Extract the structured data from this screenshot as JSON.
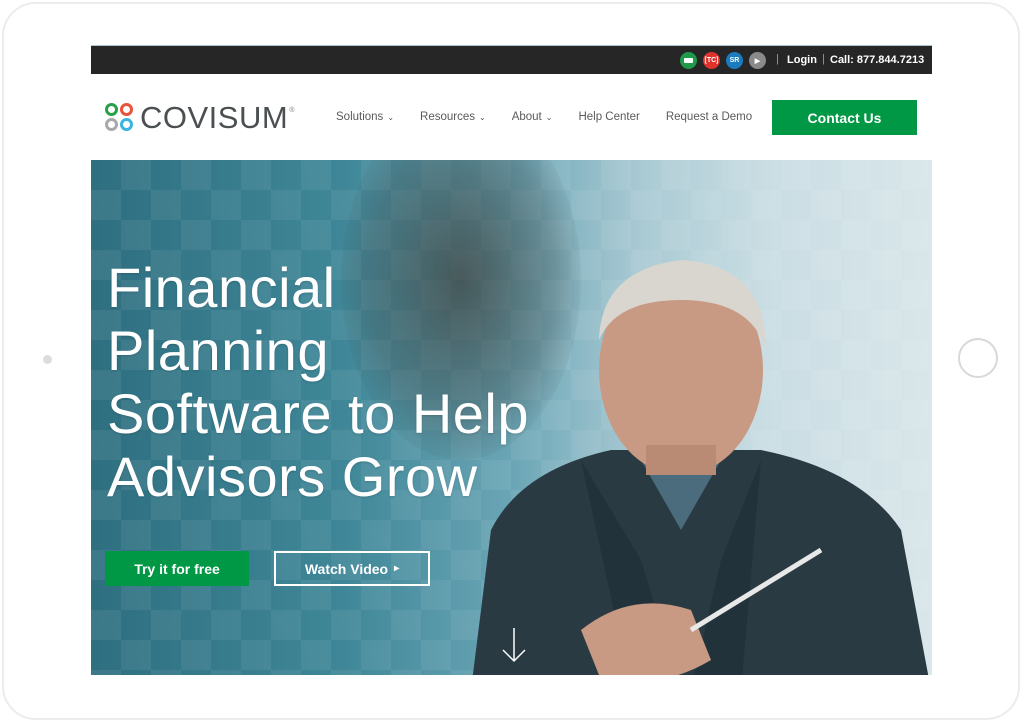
{
  "topbar": {
    "icons": [
      {
        "name": "social-green-icon",
        "label": "",
        "color": "#1e9a4a"
      },
      {
        "name": "tc-icon",
        "label": "[TC]",
        "color": "#e0322c"
      },
      {
        "name": "sr-icon",
        "label": "SR",
        "color": "#1a7bbf"
      },
      {
        "name": "play-icon",
        "label": "▶",
        "color": "#8a8a8a"
      }
    ],
    "login": "Login",
    "call": "Call: 877.844.7213"
  },
  "nav": {
    "logo_text": "COVISUM",
    "logo_reg": "®",
    "menu": [
      {
        "label": "Solutions",
        "has_dropdown": true
      },
      {
        "label": "Resources",
        "has_dropdown": true
      },
      {
        "label": "About",
        "has_dropdown": true
      },
      {
        "label": "Help Center",
        "has_dropdown": false
      },
      {
        "label": "Request a Demo",
        "has_dropdown": false
      }
    ],
    "contact_label": "Contact Us"
  },
  "hero": {
    "headline_lines": [
      "Financial",
      "Planning",
      "Software to Help",
      "Advisors Grow"
    ],
    "try_label": "Try it for free",
    "watch_label": "Watch Video",
    "watch_icon": "▸"
  },
  "colors": {
    "accent_green": "#009845",
    "topbar_bg": "#262626"
  }
}
